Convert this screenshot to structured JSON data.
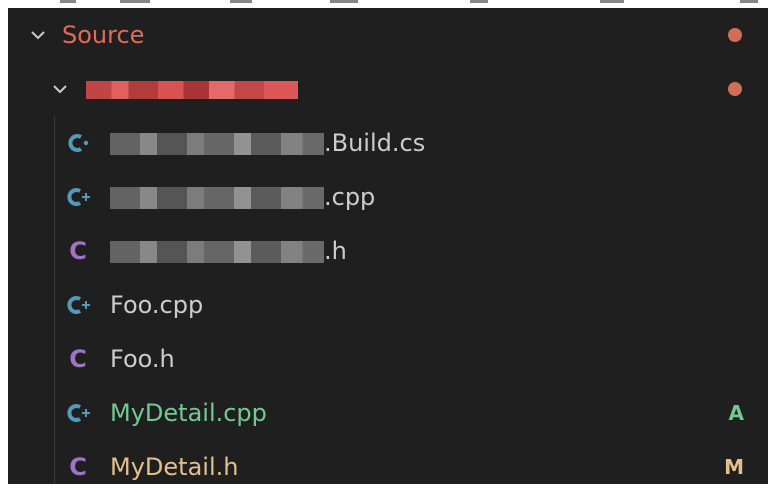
{
  "explorer": {
    "source_folder": {
      "label": "Source",
      "status": "modified-dot"
    },
    "project_folder": {
      "status": "modified-dot"
    },
    "files": [
      {
        "suffix": ".Build.cs",
        "icon": "csharp-icon",
        "badge": ""
      },
      {
        "suffix": ".cpp",
        "icon": "cpp-icon",
        "badge": ""
      },
      {
        "suffix": ".h",
        "icon": "c-header-icon",
        "badge": ""
      },
      {
        "name": "Foo.cpp",
        "icon": "cpp-icon",
        "badge": ""
      },
      {
        "name": "Foo.h",
        "icon": "c-header-icon",
        "badge": ""
      },
      {
        "name": "MyDetail.cpp",
        "icon": "cpp-icon",
        "badge": "A",
        "color": "#73c991"
      },
      {
        "name": "MyDetail.h",
        "icon": "c-header-icon",
        "badge": "M",
        "color": "#e2c08d"
      }
    ],
    "colors": {
      "background": "#1f1f1f",
      "folder_modified": "#e06c57",
      "file_default": "#cccccc",
      "added": "#73c991",
      "modified": "#e2c08d",
      "cpp_icon": "#519aba",
      "c_icon": "#a074c4"
    },
    "icon_glyphs": {
      "c": "C"
    }
  }
}
